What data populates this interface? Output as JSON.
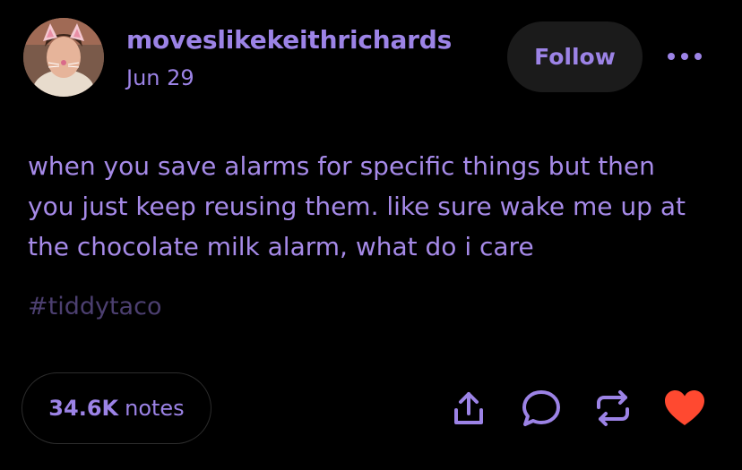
{
  "post": {
    "author": "moveslikekeithrichards",
    "date": "Jun 29",
    "follow_label": "Follow",
    "body_lines": [
      "when you save alarms for specific things but then",
      "you just keep reusing them. like sure wake me up at",
      "the chocolate milk alarm, what do i care"
    ],
    "tag": "#tiddytaco",
    "notes_count": "34.6K",
    "notes_label": "notes"
  },
  "colors": {
    "accent": "#9c83e6",
    "body_text": "#a68ae8",
    "tag": "#4c3f70",
    "like": "#ff4930",
    "background": "#000000",
    "follow_bg": "#1b1b1b"
  },
  "icons": {
    "more": "more-dots-icon",
    "share": "share-icon",
    "reply": "reply-bubble-icon",
    "reblog": "reblog-icon",
    "like": "heart-icon"
  }
}
